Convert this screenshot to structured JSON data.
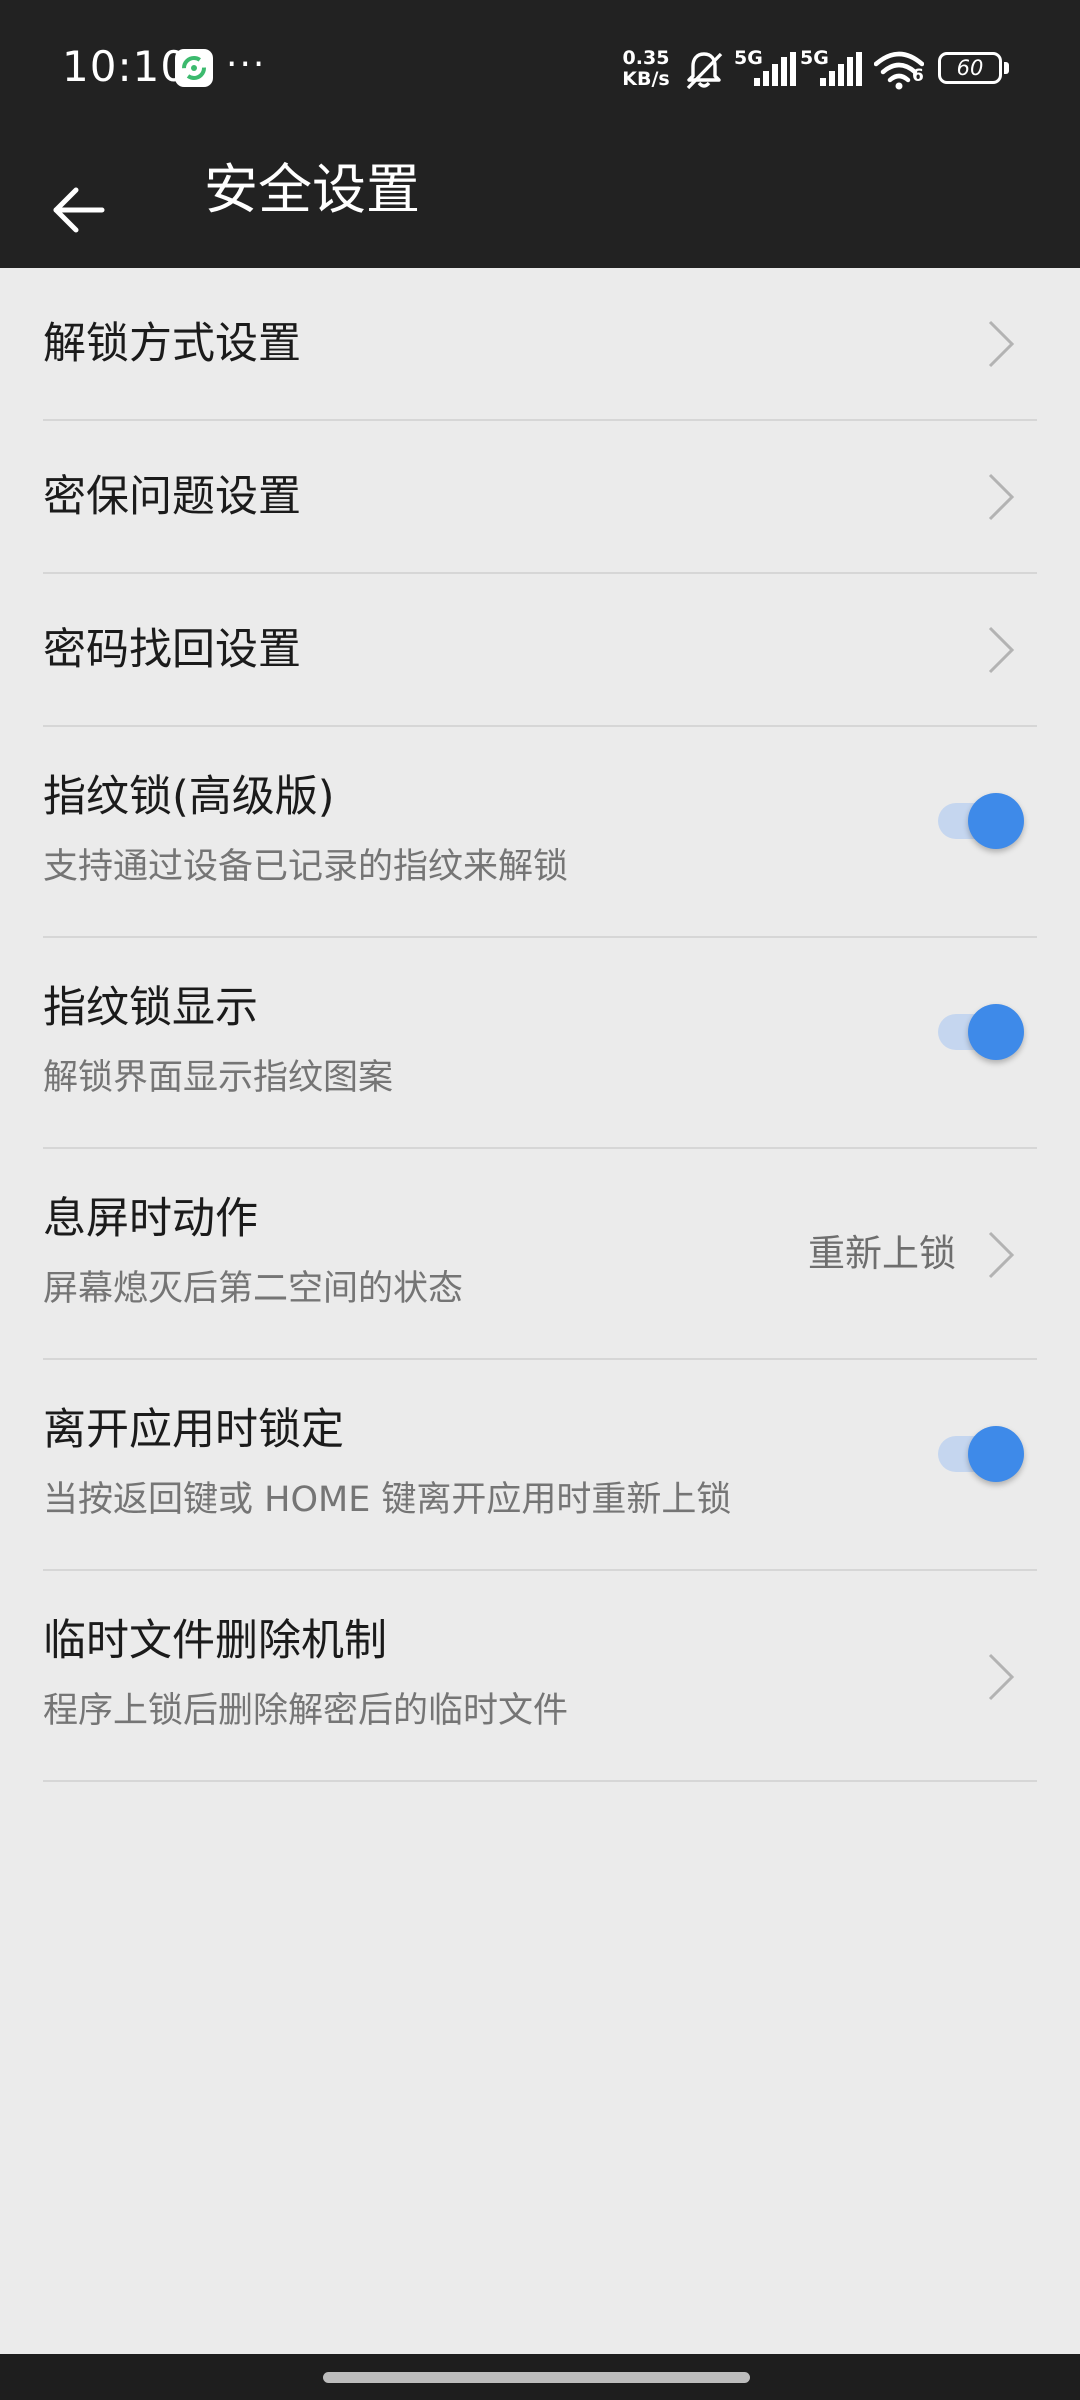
{
  "status_bar": {
    "time": "10:10",
    "more": "···",
    "net_speed_value": "0.35",
    "net_speed_unit": "KB/s",
    "signal_1_label": "5G",
    "signal_2_label": "5G",
    "wifi_label": "6",
    "battery_level": "60"
  },
  "app_bar": {
    "title": "安全设置"
  },
  "settings": {
    "unlock_method": {
      "title": "解锁方式设置"
    },
    "security_question": {
      "title": "密保问题设置"
    },
    "password_recovery": {
      "title": "密码找回设置"
    },
    "fingerprint_lock": {
      "title": "指纹锁(高级版)",
      "subtitle": "支持通过设备已记录的指纹来解锁",
      "enabled": true
    },
    "fingerprint_display": {
      "title": "指纹锁显示",
      "subtitle": "解锁界面显示指纹图案",
      "enabled": true
    },
    "screen_off_action": {
      "title": "息屏时动作",
      "subtitle": "屏幕熄灭后第二空间的状态",
      "value": "重新上锁"
    },
    "lock_on_leave": {
      "title": "离开应用时锁定",
      "subtitle": "当按返回键或 HOME 键离开应用时重新上锁",
      "enabled": true
    },
    "temp_file_deletion": {
      "title": "临时文件删除机制",
      "subtitle": "程序上锁后删除解密后的临时文件"
    }
  },
  "colors": {
    "bar_background": "#222222",
    "page_background": "#ebebeb",
    "toggle_accent": "#3e8ae9",
    "toggle_track": "#c5d6ef"
  },
  "icons": {
    "back": "arrow-left-icon",
    "chevron": "chevron-right-icon",
    "muted": "bell-muted-icon",
    "wifi": "wifi-icon",
    "battery": "battery-icon"
  }
}
